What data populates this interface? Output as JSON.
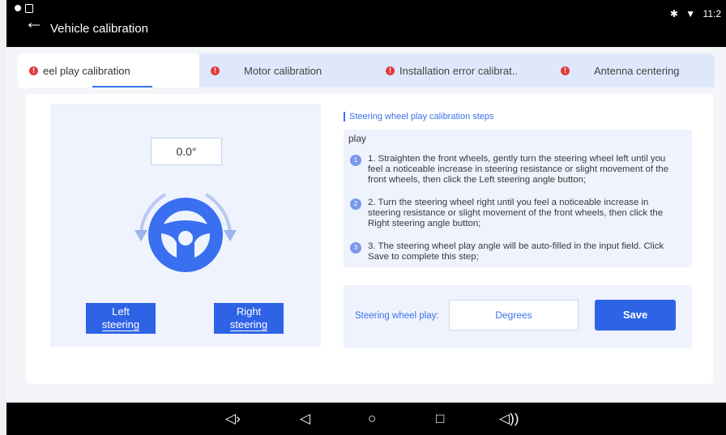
{
  "status_bar": {
    "time": "11:2",
    "bluetooth": "✱",
    "wifi": "▼"
  },
  "header": {
    "title": "Vehicle calibration",
    "back_icon": "arrow-left-icon"
  },
  "tabs": [
    {
      "label": "eel play calibration",
      "active": true
    },
    {
      "label": "Motor calibration",
      "active": false
    },
    {
      "label": "Installation error calibrat..",
      "active": false
    },
    {
      "label": "Antenna centering",
      "active": false
    }
  ],
  "left": {
    "angle_value": "0.0°",
    "left_button_line1": "Left",
    "left_button_line2": "steering",
    "right_button_line1": "Right",
    "right_button_line2": "steering"
  },
  "steps": {
    "title": "Steering wheel play calibration steps",
    "intro": "play",
    "items": [
      {
        "num": "1",
        "text": "1. Straighten the front wheels, gently turn the steering wheel left until you feel a noticeable increase in steering resistance or slight movement of the front wheels, then click the Left steering angle button;"
      },
      {
        "num": "2",
        "text": "2. Turn the steering wheel right until you feel a noticeable increase in steering resistance or slight movement of the front wheels, then click the Right steering angle button;"
      },
      {
        "num": "3",
        "text": "3. The steering wheel play angle will be auto-filled in the input field. Click Save to complete this step;"
      }
    ]
  },
  "save": {
    "label": "Steering wheel play:",
    "placeholder": "Degrees",
    "button": "Save"
  },
  "navbar": {
    "vol_down": "◁›",
    "back": "◁",
    "home": "○",
    "recents": "□",
    "vol_up": "◁))"
  },
  "colors": {
    "accent": "#2e63e6",
    "tab_bg": "#dfe8fb",
    "panel_bg": "#eef3fd",
    "warn": "#e23a3a"
  }
}
